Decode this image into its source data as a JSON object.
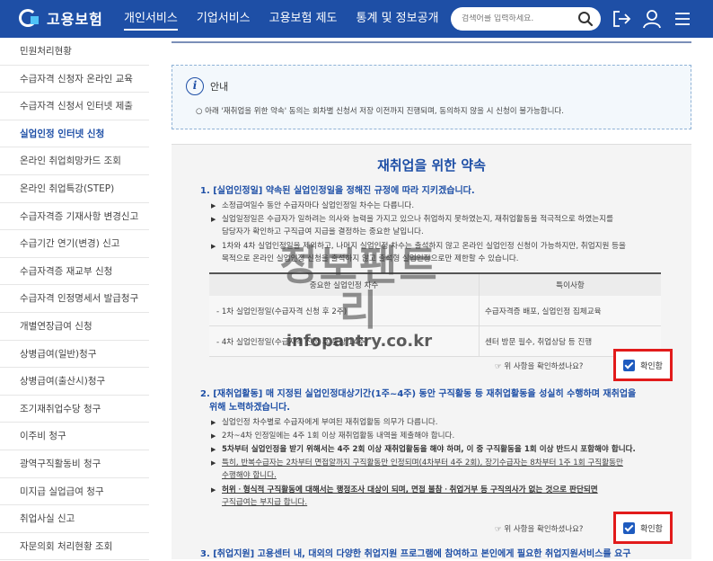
{
  "header": {
    "logo_text": "고용보험",
    "nav": [
      "개인서비스",
      "기업서비스",
      "고용보험 제도",
      "통계 및 정보공개"
    ],
    "search_placeholder": "검색어를 입력하세요."
  },
  "sidebar": {
    "items": [
      "민원처리현황",
      "수급자격 신청자 온라인 교육",
      "수급자격 신청서 인터넷 제출",
      "실업인정 인터넷 신청",
      "온라인 취업희망카드 조회",
      "온라인 취업특강(STEP)",
      "수급자격증 기재사항 변경신고",
      "수급기간 연기(변경) 신고",
      "수급자격증 재교부 신청",
      "수급자격 인정명세서 발급청구",
      "개별연장급여 신청",
      "상병급여(일반)청구",
      "상병급여(출산시)청구",
      "조기재취업수당 청구",
      "이주비 청구",
      "광역구직활동비 청구",
      "미지급 실업급여 청구",
      "취업사실 신고",
      "자문의회 처리현황 조회"
    ]
  },
  "notice": {
    "title": "안내",
    "text": "○ 아래 '재취업을 위한 약속' 동의는 회차별 신청서 저장 이전까지 진행되며, 동의하지 않을 시 신청이 불가능합니다."
  },
  "pledge": {
    "title": "재취업을 위한 약속",
    "section1": {
      "head": "1. [실업인정일] 약속된 실업인정일을 정해진 규정에 따라 지키겠습니다.",
      "b1": "소정급여일수 동안 수급자마다 실업인정일 차수는 다릅니다.",
      "b2_l1": "실업일정일은 수급자가 일하려는 의사와 능력을 가지고 있으나 취업하지 못하였는지, 재취업활동을 적극적으로 하였는지를",
      "b2_l2": "담당자가 확인하고 구직급여 지급을 결정하는 중요한 날입니다.",
      "b3_l1": "1차와 4차 실업인정일을 제외하고, 나머지 실업인정 차수는 출석하지 않고 온라인 실업인정 신청이 가능하지만, 취업지원 등을",
      "b3_l2": "목적으로 온라인 실업인정 신청을 출석하지 않고 출석형 실업인정으로만 제한할 수 있습니다.",
      "table": {
        "headers": [
          "중요한 실업인정 차수",
          "특이사항"
        ],
        "rows": [
          [
            "- 1차 실업인정일(수급자격 신청 후 2주)",
            "수급자격증 배포, 실업인정 집체교육"
          ],
          [
            "- 4차 실업인정일(수급자격 신청 후 통상 14주)",
            "센터 방문 필수, 취업상담 등 진행"
          ]
        ]
      },
      "confirm_question": "☞ 위 사항을 확인하셨나요?",
      "confirm_label": "확인함"
    },
    "section2": {
      "head_l1": "2. [재취업활동] 매 지정된 실업인정대상기간(1주~4주) 동안 구직활동 등 재취업활동을 성실히 수행하며 재취업을",
      "head_l2": "위해 노력하겠습니다.",
      "b1": "실업인정 차수별로 수급자에게 부여된 재취업활동 의무가 다릅니다.",
      "b2": "2차~4차 인정일에는 4주 1회 이상 재취업활동 내역을 제출해야 합니다.",
      "b3": "5차부터 실업인정을 받기 위해서는 4주 2회 이상 재취업활동을 해야 하며, 이 중 구직활동을 1회 이상 반드시 포함해야 합니다.",
      "b4_l1": "특히, 반복수급자는 2차부터 면접알까지 구직활동만 인정되며(4차부터 4주 2회), 장기수급자는 8차부터 1주 1회 구직활동만",
      "b4_l2": "수행해야 합니다.",
      "b5_l1": "허위ㆍ형식적 구직활동에 대해서는 행정조사 대상이 되며, 면접 불참ㆍ취업거부 등 구직의사가 없는 것으로 판단되면",
      "b5_l2": "구직급여는 부지급 합니다.",
      "confirm_question": "☞ 위 사항을 확인하셨나요?",
      "confirm_label": "확인함"
    },
    "section3": {
      "head": "3. [취업지원] 고용센터 내, 대외의 다양한 취업지원 프로그램에 참여하고 본인에게 필요한 취업지원서비스를 요구"
    }
  },
  "watermark": {
    "big": "정보팬트리",
    "small": "infopantry.co.kr"
  },
  "colors": {
    "brand": "#1e4fa6",
    "highlight": "#e21b1b",
    "checkbox": "#1e5bbf"
  }
}
